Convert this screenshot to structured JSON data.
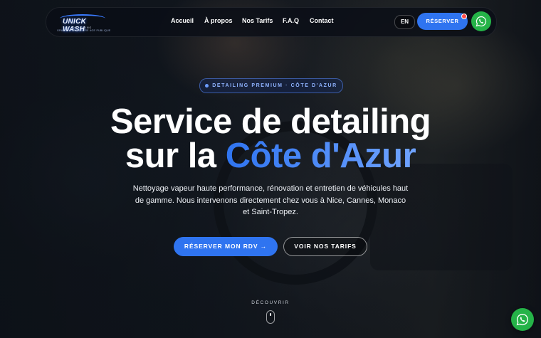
{
  "brand": {
    "logo_text": "UNICK WASH",
    "logo_sub": "DETAILING",
    "logo_tagline": "GRAND PROPRIETAIRE AGE PUBLIQUE"
  },
  "nav": {
    "links": [
      "Accueil",
      "À propos",
      "Nos Tarifs",
      "F.A.Q",
      "Contact"
    ],
    "lang": "EN",
    "reserve_label": "RÉSERVER"
  },
  "hero": {
    "badge": "DETAILING PREMIUM · CÔTE D'AZUR",
    "title_line1": "Service de detailing",
    "title_line2_plain": "sur la ",
    "title_line2_accent": "Côte d'Azur",
    "description": "Nettoyage vapeur haute performance, rénovation et entretien de véhicules haut de gamme. Nous intervenons directement chez vous à Nice, Cannes, Monaco et Saint-Tropez.",
    "cta_primary": "RÉSERVER MON RDV",
    "cta_primary_arrow": "→",
    "cta_secondary": "VOIR NOS TARIFS",
    "scroll_label": "DÉCOUVRIR"
  },
  "colors": {
    "accent": "#2f74f0",
    "whatsapp": "#25b348",
    "notification": "#ff4b4b"
  },
  "icons": {
    "whatsapp": "whatsapp-icon",
    "arrow": "arrow-right-icon",
    "scroll": "mouse-scroll-icon"
  }
}
